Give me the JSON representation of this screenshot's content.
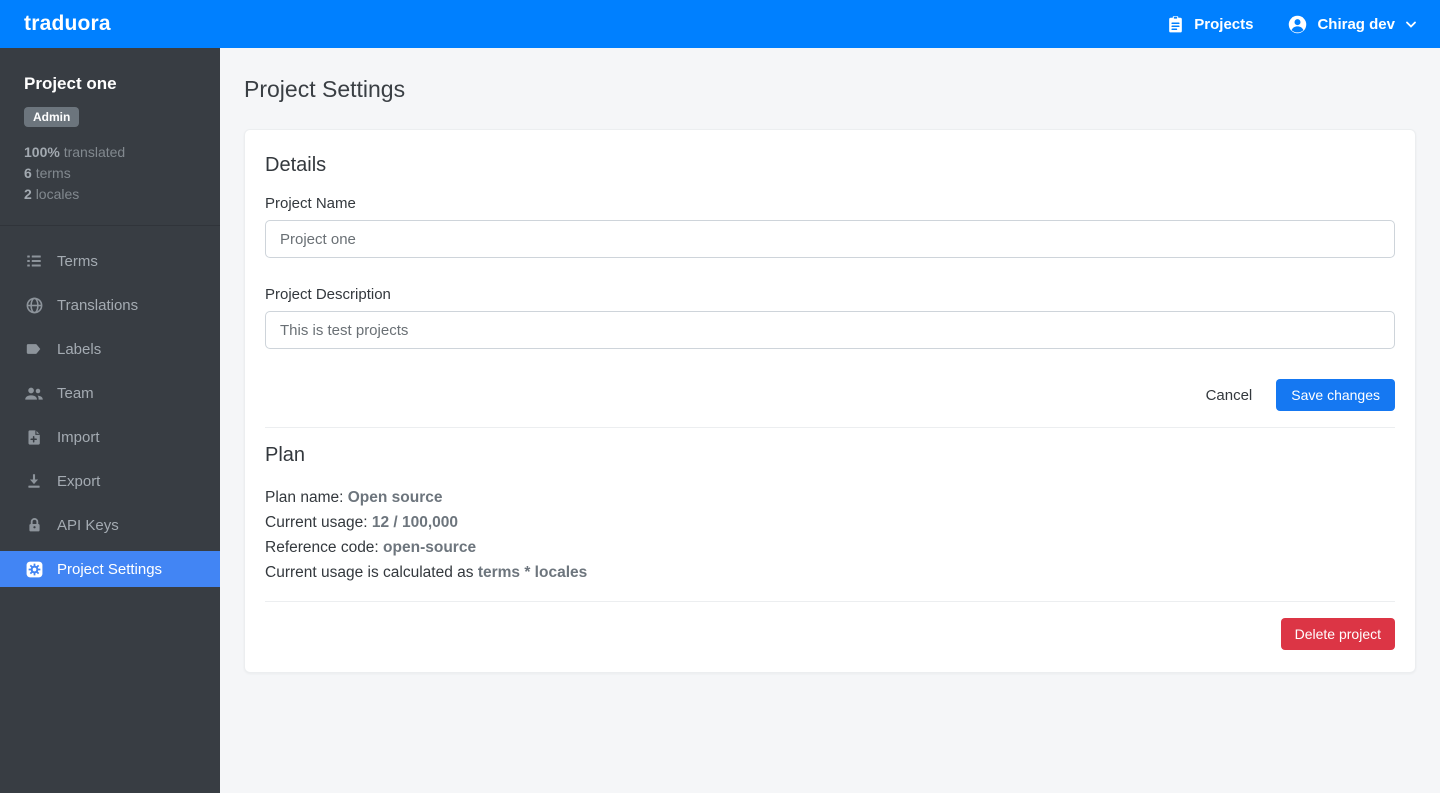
{
  "brand": {
    "logo": "traduora"
  },
  "navbar": {
    "projects_label": "Projects",
    "user_name": "Chirag dev"
  },
  "sidebar": {
    "project_name": "Project one",
    "role_badge": "Admin",
    "stats": [
      {
        "value": "100%",
        "label": "translated"
      },
      {
        "value": "6",
        "label": "terms"
      },
      {
        "value": "2",
        "label": "locales"
      }
    ],
    "items": [
      {
        "label": "Terms",
        "icon": "list-icon",
        "active": false
      },
      {
        "label": "Translations",
        "icon": "globe-icon",
        "active": false
      },
      {
        "label": "Labels",
        "icon": "label-icon",
        "active": false
      },
      {
        "label": "Team",
        "icon": "people-icon",
        "active": false
      },
      {
        "label": "Import",
        "icon": "file-plus-icon",
        "active": false
      },
      {
        "label": "Export",
        "icon": "download-icon",
        "active": false
      },
      {
        "label": "API Keys",
        "icon": "lock-icon",
        "active": false
      },
      {
        "label": "Project Settings",
        "icon": "gear-icon",
        "active": true
      }
    ]
  },
  "main": {
    "page_title": "Project Settings",
    "details": {
      "heading": "Details",
      "name_label": "Project Name",
      "name_value": "Project one",
      "description_label": "Project Description",
      "description_value": "This is test projects",
      "cancel_label": "Cancel",
      "save_label": "Save changes"
    },
    "plan": {
      "heading": "Plan",
      "rows": [
        {
          "text": "Plan name: ",
          "value": "Open source"
        },
        {
          "text": "Current usage: ",
          "value": "12 / 100,000"
        },
        {
          "text": "Reference code: ",
          "value": "open-source"
        },
        {
          "text": "Current usage is calculated as ",
          "value": "terms * locales"
        }
      ],
      "delete_label": "Delete project"
    }
  },
  "colors": {
    "navbar_blue": "#0080ff",
    "active_item_blue": "#4285f4",
    "primary_button_blue": "#1578f2",
    "danger_red": "#dc3545",
    "sidebar_bg": "#383d43"
  }
}
